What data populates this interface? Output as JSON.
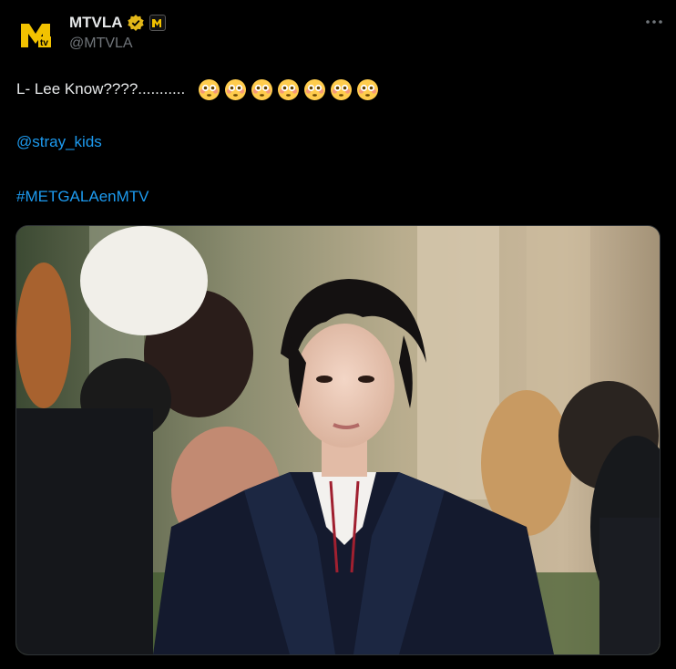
{
  "account": {
    "display_name": "MTVLA",
    "handle": "@MTVLA",
    "verified_color": "#f4b400",
    "avatar_icon": "mtv-logo-icon"
  },
  "tweet": {
    "text": "L- Lee Know????...........",
    "emoji_count": 7,
    "emoji_name": "flushed-face-emoji",
    "mention": "@stray_kids",
    "hashtag": "#METGALAenMTV"
  },
  "media": {
    "description_icon": "photo"
  },
  "colors": {
    "background": "#000000",
    "text": "#e7e9ea",
    "secondary": "#71767b",
    "link": "#1d9bf0"
  }
}
